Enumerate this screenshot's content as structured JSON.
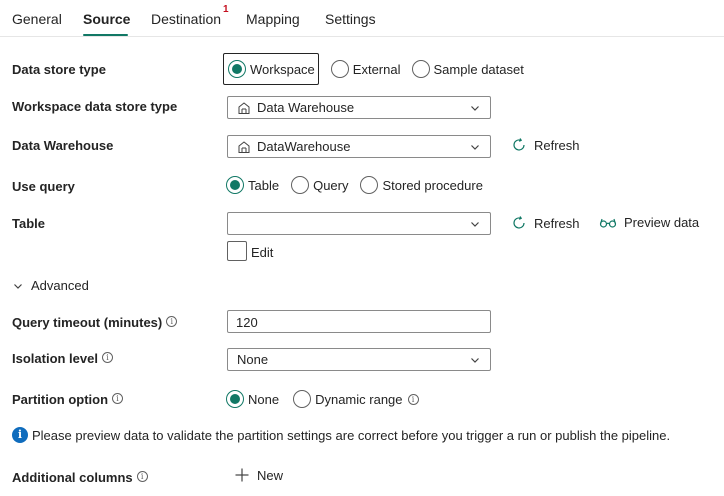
{
  "tabs": {
    "general": "General",
    "source": "Source",
    "destination": "Destination",
    "destination_badge": "1",
    "mapping": "Mapping",
    "settings": "Settings"
  },
  "form": {
    "data_store_type": {
      "label": "Data store type",
      "options": [
        "Workspace",
        "External",
        "Sample dataset"
      ],
      "selected": "Workspace"
    },
    "workspace_data_store_type": {
      "label": "Workspace data store type",
      "value": "Data Warehouse"
    },
    "data_warehouse": {
      "label": "Data Warehouse",
      "value": "DataWarehouse",
      "refresh_label": "Refresh"
    },
    "use_query": {
      "label": "Use query",
      "options": [
        "Table",
        "Query",
        "Stored procedure"
      ],
      "selected": "Table"
    },
    "table": {
      "label": "Table",
      "value": "",
      "refresh_label": "Refresh",
      "preview_label": "Preview data",
      "edit_label": "Edit"
    },
    "advanced_label": "Advanced",
    "query_timeout": {
      "label": "Query timeout (minutes)",
      "value": "120"
    },
    "isolation_level": {
      "label": "Isolation level",
      "value": "None"
    },
    "partition_option": {
      "label": "Partition option",
      "options": [
        "None",
        "Dynamic range"
      ],
      "selected": "None"
    },
    "info_message": "Please preview data to validate the partition settings are correct before you trigger a run or publish the pipeline.",
    "additional_columns": {
      "label": "Additional columns",
      "new_label": "New"
    }
  },
  "colors": {
    "accent": "#117865",
    "info_blue": "#0f6cbd",
    "badge_red": "#c50f1f"
  }
}
